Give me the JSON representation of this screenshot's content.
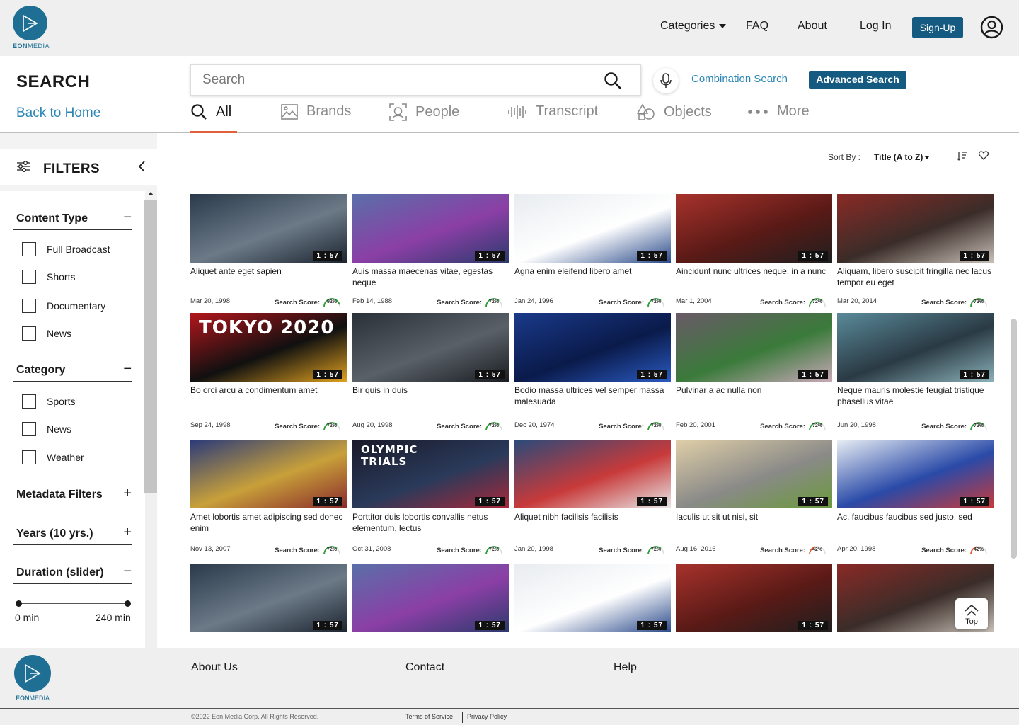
{
  "brand": {
    "name_bold": "EON",
    "name_light": "MEDIA"
  },
  "nav": {
    "categories": "Categories",
    "faq": "FAQ",
    "about": "About",
    "login": "Log In",
    "signup": "Sign-Up"
  },
  "search": {
    "title": "SEARCH",
    "back_home": "Back to Home",
    "placeholder": "Search",
    "combination": "Combination Search",
    "advanced": "Advanced Search"
  },
  "tabs": [
    {
      "label": "All",
      "icon": "search-icon"
    },
    {
      "label": "Brands",
      "icon": "image-icon"
    },
    {
      "label": "People",
      "icon": "face-scan-icon"
    },
    {
      "label": "Transcript",
      "icon": "waveform-icon"
    },
    {
      "label": "Objects",
      "icon": "shapes-icon"
    },
    {
      "label": "More",
      "icon": "more-dots-icon"
    }
  ],
  "filters": {
    "title": "FILTERS",
    "content_type": {
      "label": "Content Type",
      "sign": "−",
      "options": [
        "Full Broadcast",
        "Shorts",
        "Documentary",
        "News"
      ]
    },
    "category": {
      "label": "Category",
      "sign": "−",
      "options": [
        "Sports",
        "News",
        "Weather"
      ]
    },
    "metadata": {
      "label": "Metadata Filters",
      "sign": "+"
    },
    "years": {
      "label": "Years (10 yrs.)",
      "sign": "+"
    },
    "duration": {
      "label": "Duration (slider)",
      "sign": "−",
      "min": "0 min",
      "max": "240 min"
    }
  },
  "sort": {
    "label": "Sort By :",
    "value": "Title (A to Z)"
  },
  "search_score_label": "Search Score:",
  "cards": [
    {
      "title": "Aliquet ante eget sapien",
      "date": "Mar 20, 1998",
      "score": "92%",
      "score_color": "#2e9e3a",
      "duration": "1 : 57",
      "thumb": [
        "#2a3a4a",
        "#6c7a88",
        "#1c2530"
      ]
    },
    {
      "title": "Auis massa maecenas vitae, egestas neque",
      "date": "Feb 14, 1988",
      "score": "72%",
      "score_color": "#2e9e3a",
      "duration": "1 : 57",
      "thumb": [
        "#5a6fa8",
        "#8b3fa6",
        "#2c3a6c"
      ]
    },
    {
      "title": "Agna enim eleifend libero amet",
      "date": "Jan 24, 1996",
      "score": "72%",
      "score_color": "#2e9e3a",
      "duration": "1 : 57",
      "thumb": [
        "#e8ecf0",
        "#ffffff",
        "#2a4a8a"
      ]
    },
    {
      "title": "Aincidunt nunc ultrices neque, in a nunc",
      "date": "Mar 1, 2004",
      "score": "72%",
      "score_color": "#2e9e3a",
      "duration": "1 : 57",
      "thumb": [
        "#a8322c",
        "#5a1a16",
        "#1f1f1f"
      ]
    },
    {
      "title": "Aliquam, libero suscipit fringilla nec lacus tempor eu eget",
      "date": "Mar 20, 2014",
      "score": "72%",
      "score_color": "#2e9e3a",
      "duration": "1 : 57",
      "thumb": [
        "#8a2a26",
        "#3a2c28",
        "#c8c0b8"
      ]
    },
    {
      "title": "Bo orci arcu a condimentum amet",
      "date": "Sep 24, 1998",
      "score": "72%",
      "score_color": "#2e9e3a",
      "duration": "1 : 57",
      "thumb": [
        "#b3161c",
        "#101010",
        "#e0a020"
      ],
      "overlay": "TOKYO 2020"
    },
    {
      "title": "Bir quis in duis",
      "date": "Aug 20, 1998",
      "score": "72%",
      "score_color": "#2e9e3a",
      "duration": "1 : 57",
      "thumb": [
        "#2a3038",
        "#5a6068",
        "#1a1e22"
      ]
    },
    {
      "title": "Bodio massa ultrices vel semper massa malesuada",
      "date": "Dec 20, 1974",
      "score": "72%",
      "score_color": "#2e9e3a",
      "duration": "1 : 57",
      "thumb": [
        "#1a3a8a",
        "#0a1a4a",
        "#2a5ac0"
      ]
    },
    {
      "title": "Pulvinar a ac nulla non",
      "date": "Feb 20, 2001",
      "score": "72%",
      "score_color": "#2e9e3a",
      "duration": "1 : 57",
      "thumb": [
        "#6a5a68",
        "#3a7a3a",
        "#c8a8b8"
      ]
    },
    {
      "title": "Neque mauris molestie feugiat tristique phasellus vitae",
      "date": "Jun 20, 1998",
      "score": "72%",
      "score_color": "#2e9e3a",
      "duration": "1 : 57",
      "thumb": [
        "#5a8a9a",
        "#2a3a44",
        "#8ab0b8"
      ]
    },
    {
      "title": "Amet lobortis amet adipiscing sed donec enim",
      "date": "Nov 13, 2007",
      "score": "72%",
      "score_color": "#2e9e3a",
      "duration": "1 : 57",
      "thumb": [
        "#2a3a7a",
        "#c8a03a",
        "#8a2a2a"
      ]
    },
    {
      "title": "Porttitor duis lobortis convallis netus elementum, lectus",
      "date": "Oct 31, 2008",
      "score": "72%",
      "score_color": "#2e9e3a",
      "duration": "1 : 57",
      "thumb": [
        "#1a1a2a",
        "#2a3a5a",
        "#a8283a"
      ],
      "overlay": "OLYMPIC TRIALS"
    },
    {
      "title": "Aliquet nibh facilisis facilisis",
      "date": "Jan 20, 1998",
      "score": "72%",
      "score_color": "#2e9e3a",
      "duration": "1 : 57",
      "thumb": [
        "#2a4a7a",
        "#c83a3a",
        "#e8e8e8"
      ]
    },
    {
      "title": "Iaculis ut sit ut nisi, sit",
      "date": "Aug 16, 2016",
      "score": "42%",
      "score_color": "#e05a2a",
      "duration": "1 : 57",
      "thumb": [
        "#e0cfa8",
        "#8a8a88",
        "#6a9a3a"
      ]
    },
    {
      "title": "Ac, faucibus faucibus sed justo, sed",
      "date": "Apr 20, 1998",
      "score": "42%",
      "score_color": "#e05a2a",
      "duration": "1 : 57",
      "thumb": [
        "#e8eef4",
        "#2a4aa8",
        "#c83a3a"
      ]
    },
    {
      "title": "",
      "date": "",
      "score": "",
      "score_color": "#2e9e3a",
      "duration": "1 : 57",
      "thumb": [
        "#2a3a4a",
        "#6c7a88",
        "#1c2530"
      ]
    },
    {
      "title": "",
      "date": "",
      "score": "",
      "score_color": "#2e9e3a",
      "duration": "1 : 57",
      "thumb": [
        "#5a6fa8",
        "#8b3fa6",
        "#2c3a6c"
      ]
    },
    {
      "title": "",
      "date": "",
      "score": "",
      "score_color": "#2e9e3a",
      "duration": "1 : 57",
      "thumb": [
        "#e8ecf0",
        "#ffffff",
        "#2a4a8a"
      ]
    },
    {
      "title": "",
      "date": "",
      "score": "",
      "score_color": "#2e9e3a",
      "duration": "1 : 57",
      "thumb": [
        "#a8322c",
        "#5a1a16",
        "#1f1f1f"
      ]
    },
    {
      "title": "",
      "date": "",
      "score": "",
      "score_color": "#2e9e3a",
      "duration": "",
      "thumb": [
        "#8a2a26",
        "#3a2c28",
        "#c8c0b8"
      ]
    }
  ],
  "top_button": "Top",
  "footer": {
    "about": "About Us",
    "contact": "Contact",
    "help": "Help",
    "copyright": "©2022 Eon Media Corp. All Rights Reserved.",
    "terms": "Terms of Service",
    "privacy": "Privacy Policy"
  }
}
